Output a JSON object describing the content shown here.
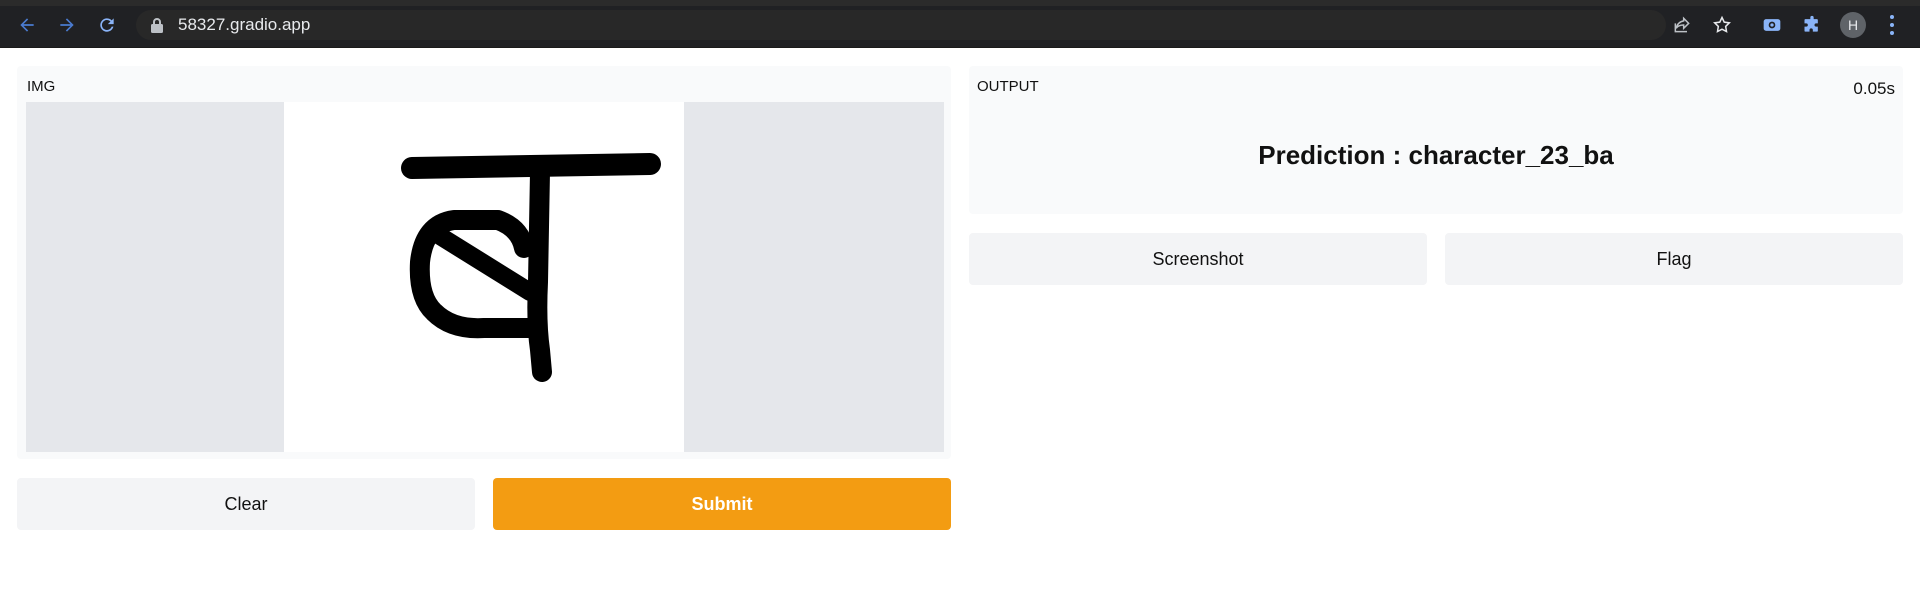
{
  "browser": {
    "url": "58327.gradio.app",
    "profile_initial": "H",
    "icons": [
      "back-arrow-icon",
      "forward-arrow-icon",
      "reload-icon",
      "lock-icon",
      "share-icon",
      "star-icon",
      "extension-screen-icon",
      "puzzle-icon",
      "more-vert-icon"
    ]
  },
  "input_panel": {
    "label": "IMG"
  },
  "output_panel": {
    "label": "OUTPUT",
    "timer": "0.05s",
    "prediction": "Prediction : character_23_ba"
  },
  "buttons": {
    "clear": "Clear",
    "submit": "Submit",
    "screenshot": "Screenshot",
    "flag": "Flag"
  },
  "colors": {
    "primary": "#f39c12",
    "secondary_bg": "#f3f4f6",
    "panel_bg": "#f9fafb",
    "canvas_bg": "#e5e7eb",
    "browser_bg": "#202124"
  }
}
